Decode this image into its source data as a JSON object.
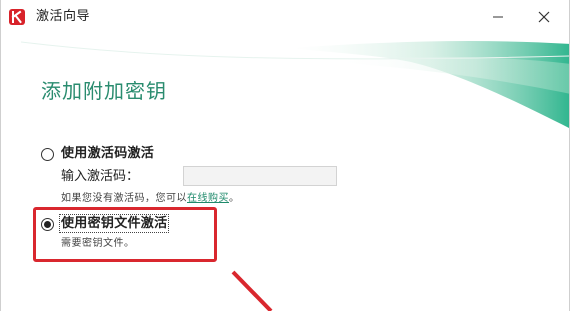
{
  "window": {
    "title": "激活向导"
  },
  "page": {
    "heading": "添加附加密钥"
  },
  "options": {
    "activation_code": {
      "label": "使用激活码激活",
      "selected": false,
      "input_label": "输入激活码：",
      "input_value": "",
      "hint_prefix": "如果您没有激活码，您可以",
      "hint_link": "在线购买",
      "hint_suffix": "。"
    },
    "key_file": {
      "label": "使用密钥文件激活",
      "selected": true,
      "hint": "需要密钥文件。"
    }
  },
  "colors": {
    "accent": "#2a8c6f",
    "highlight": "#d9272e",
    "brand": "#d8232a"
  },
  "icons": {
    "app": "kaspersky-k-icon",
    "minimize": "minimize-icon",
    "close": "close-icon",
    "arrow": "red-arrow-annotation"
  }
}
